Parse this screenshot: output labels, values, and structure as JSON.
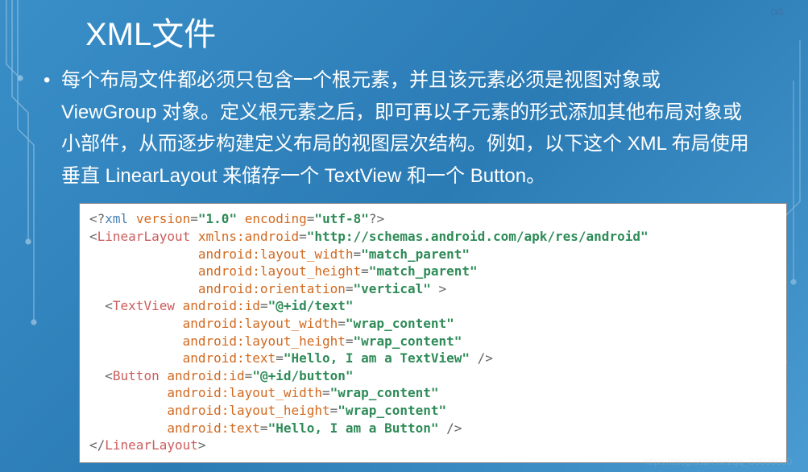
{
  "title": "XML文件",
  "bullet": "每个布局文件都必须只包含一个根元素，并且该元素必须是视图对象或 ViewGroup 对象。定义根元素之后，即可再以子元素的形式添加其他布局对象或小部件，从而逐步构建定义布局的视图层次结构。例如，以下这个 XML 布局使用垂直 LinearLayout 来储存一个 TextView 和一个 Button。",
  "code": {
    "xml_decl": {
      "version": "1.0",
      "encoding": "utf-8"
    },
    "root": {
      "tag": "LinearLayout",
      "attrs": [
        {
          "name": "xmlns:android",
          "value": "http://schemas.android.com/apk/res/android"
        },
        {
          "name": "android:layout_width",
          "value": "match_parent"
        },
        {
          "name": "android:layout_height",
          "value": "match_parent"
        },
        {
          "name": "android:orientation",
          "value": "vertical"
        }
      ],
      "children": [
        {
          "tag": "TextView",
          "attrs": [
            {
              "name": "android:id",
              "value": "@+id/text"
            },
            {
              "name": "android:layout_width",
              "value": "wrap_content"
            },
            {
              "name": "android:layout_height",
              "value": "wrap_content"
            },
            {
              "name": "android:text",
              "value": "Hello, I am a TextView"
            }
          ]
        },
        {
          "tag": "Button",
          "attrs": [
            {
              "name": "android:id",
              "value": "@+id/button"
            },
            {
              "name": "android:layout_width",
              "value": "wrap_content"
            },
            {
              "name": "android:layout_height",
              "value": "wrap_content"
            },
            {
              "name": "android:text",
              "value": "Hello, I am a Button"
            }
          ]
        }
      ]
    }
  },
  "watermark_bottom": "https://blog.csdn.net/qq_33608000"
}
